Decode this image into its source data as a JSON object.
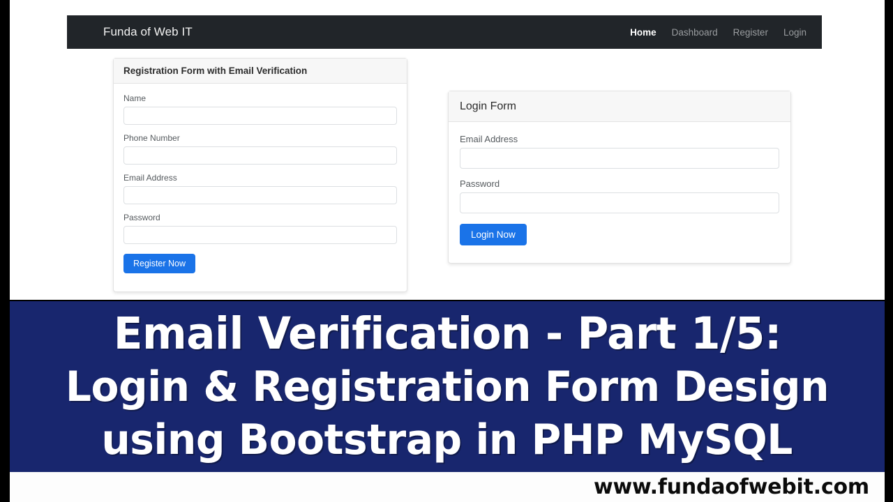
{
  "navbar": {
    "brand": "Funda of Web IT",
    "links": [
      {
        "label": "Home",
        "active": true
      },
      {
        "label": "Dashboard",
        "active": false
      },
      {
        "label": "Register",
        "active": false
      },
      {
        "label": "Login",
        "active": false
      }
    ]
  },
  "registration_form": {
    "title": "Registration Form with Email Verification",
    "fields": [
      {
        "label": "Name",
        "value": "",
        "placeholder": ""
      },
      {
        "label": "Phone Number",
        "value": "",
        "placeholder": ""
      },
      {
        "label": "Email Address",
        "value": "",
        "placeholder": ""
      },
      {
        "label": "Password",
        "value": "",
        "placeholder": ""
      }
    ],
    "submit_label": "Register Now"
  },
  "login_form": {
    "title": "Login Form",
    "fields": [
      {
        "label": "Email Address",
        "value": "",
        "placeholder": ""
      },
      {
        "label": "Password",
        "value": "",
        "placeholder": ""
      }
    ],
    "submit_label": "Login Now"
  },
  "banner": {
    "line1": "Email Verification - Part 1/5:",
    "line2": "Login & Registration Form Design",
    "line3": "using Bootstrap in PHP MySQL"
  },
  "footer": {
    "url": "www.fundaofwebit.com"
  },
  "colors": {
    "navbar_bg": "#212529",
    "banner_bg": "#18266e",
    "primary_button": "#1a73e8",
    "card_header_bg": "#f7f7f7",
    "page_bg": "#ffffff",
    "nav_link": "#9a9da0",
    "nav_link_active": "#ffffff"
  }
}
